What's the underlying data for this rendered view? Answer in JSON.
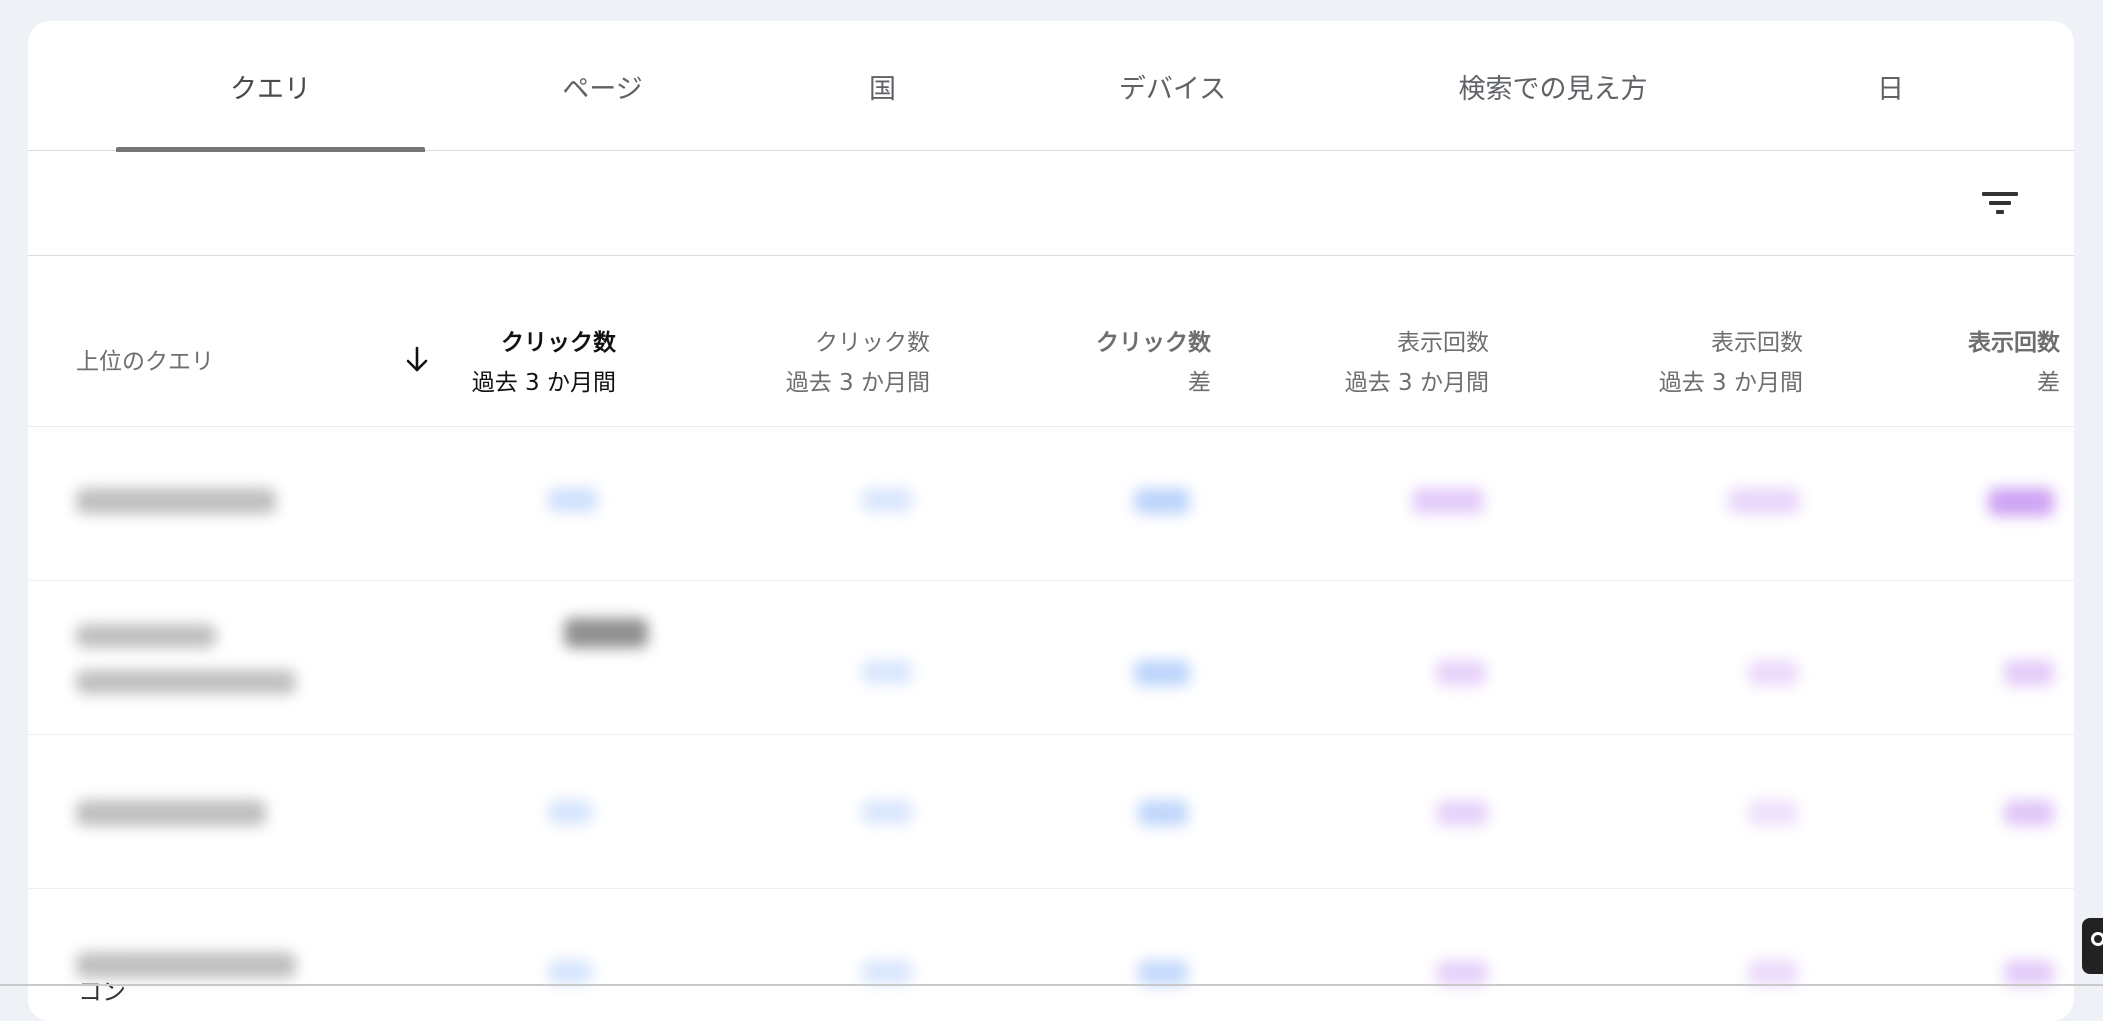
{
  "tabs": [
    {
      "label": "クエリ",
      "active": true
    },
    {
      "label": "ページ",
      "active": false
    },
    {
      "label": "国",
      "active": false
    },
    {
      "label": "デバイス",
      "active": false
    },
    {
      "label": "検索での見え方",
      "active": false
    },
    {
      "label": "日",
      "active": false
    }
  ],
  "table": {
    "columns": [
      {
        "line1": "上位のクエリ",
        "line2": ""
      },
      {
        "line1": "クリック数",
        "line2": "過去 3 か月間"
      },
      {
        "line1": "クリック数",
        "line2": "過去 3 か月間"
      },
      {
        "line1": "クリック数",
        "line2": "差"
      },
      {
        "line1": "表示回数",
        "line2": "過去 3 か月間"
      },
      {
        "line1": "表示回数",
        "line2": "過去 3 か月間"
      },
      {
        "line1": "表示回数",
        "line2": "差"
      }
    ]
  },
  "footer": {
    "partial_text": "コン"
  },
  "colors": {
    "clicks_accent": "#4285f4",
    "impressions_accent": "#9334e6",
    "tab_indicator": "#757575"
  },
  "icons": {
    "filter": "filter-list-icon",
    "sort": "arrow-down-icon",
    "side_widget": "search-icon"
  }
}
